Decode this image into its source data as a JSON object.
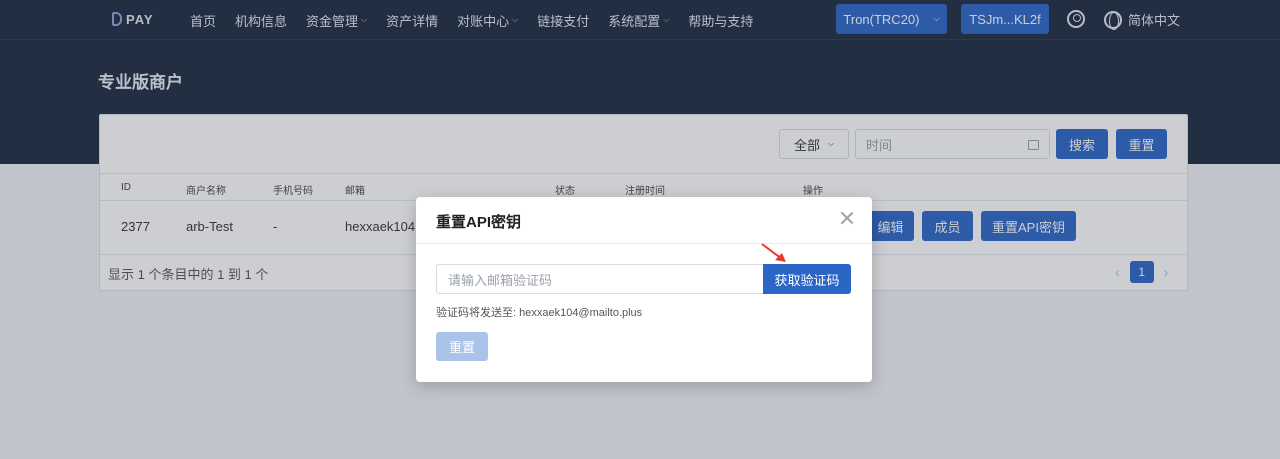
{
  "brand": {
    "logo_text": "PAY"
  },
  "nav": {
    "items": [
      {
        "label": "首页",
        "dropdown": false
      },
      {
        "label": "机构信息",
        "dropdown": false
      },
      {
        "label": "资金管理",
        "dropdown": true
      },
      {
        "label": "资产详情",
        "dropdown": false
      },
      {
        "label": "对账中心",
        "dropdown": true
      },
      {
        "label": "链接支付",
        "dropdown": false
      },
      {
        "label": "系统配置",
        "dropdown": true
      },
      {
        "label": "帮助与支持",
        "dropdown": false
      }
    ],
    "chain_selector": "Tron(TRC20)",
    "wallet": "TSJm...KL2f",
    "language": "简体中文",
    "icons": {
      "user": "user-circle-icon",
      "language": "globe-icon"
    }
  },
  "page": {
    "title": "专业版商户"
  },
  "filters": {
    "status_select": "全部",
    "time_placeholder": "时间",
    "search_button": "搜索",
    "reset_button": "重置"
  },
  "table": {
    "columns": {
      "id": "ID",
      "name": "商户名称",
      "phone": "手机号码",
      "email": "邮箱",
      "status": "状态",
      "reg_time": "注册时间",
      "actions": "操作"
    },
    "rows": [
      {
        "id": "2377",
        "name": "arb-Test",
        "phone": "-",
        "email": "hexxaek104@"
      }
    ],
    "row_actions": {
      "edit": "编辑",
      "members": "成员",
      "reset_api_key": "重置API密钥"
    }
  },
  "pagination": {
    "info": "显示 1 个条目中的 1 到 1 个",
    "current_page": "1"
  },
  "modal": {
    "title": "重置API密钥",
    "code_placeholder": "请输入邮箱验证码",
    "get_code_button": "获取验证码",
    "hint": "验证码将发送至: hexxaek104@mailto.plus",
    "reset_button": "重置"
  },
  "colors": {
    "primary": "#2b66c7",
    "header_bg": "#1c2a3f",
    "disabled_button": "#a9c3ea",
    "annotation_arrow": "#e53b2c"
  }
}
